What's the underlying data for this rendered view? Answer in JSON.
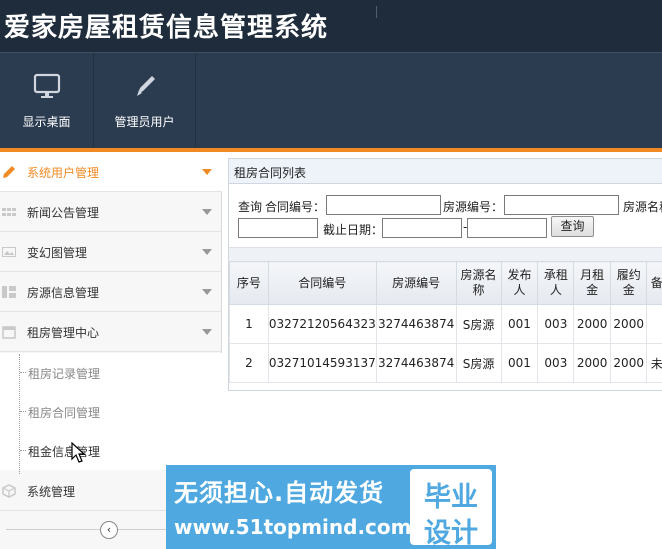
{
  "app": {
    "title": "爱家房屋租赁信息管理系统"
  },
  "toolbar": {
    "items": [
      {
        "label": "显示桌面",
        "icon": "monitor-icon"
      },
      {
        "label": "管理员用户",
        "icon": "pencil-icon"
      }
    ]
  },
  "sidebar": {
    "menus": [
      {
        "label": "系统用户管理",
        "icon": "pencil-icon",
        "active": true
      },
      {
        "label": "新闻公告管理",
        "icon": "grid-icon"
      },
      {
        "label": "变幻图管理",
        "icon": "image-icon"
      },
      {
        "label": "房源信息管理",
        "icon": "tiles-icon"
      },
      {
        "label": "租房管理中心",
        "icon": "calendar-icon",
        "expanded": true
      }
    ],
    "submenus": [
      {
        "label": "租房记录管理"
      },
      {
        "label": "租房合同管理"
      },
      {
        "label": "租金信息管理",
        "current": true
      }
    ],
    "bottom_menu": {
      "label": "系统管理",
      "icon": "box-icon"
    },
    "collapse_glyph": "‹"
  },
  "panel": {
    "title": "租房合同列表",
    "search": {
      "query_label": "查询",
      "contract_no_label": "合同编号：",
      "house_no_label": "房源编号：",
      "house_name_label": "房源名称",
      "deadline_label": "截止日期：",
      "date_separator": "-",
      "contract_no_value": "",
      "house_no_value": "",
      "house_name_value": "",
      "date_from_value": "",
      "date_to_value": "",
      "button_label": "查询"
    },
    "table": {
      "headers": [
        "序号",
        "合同编号",
        "房源编号",
        "房源名称",
        "发布人",
        "承租人",
        "月租金",
        "履约金",
        "备"
      ],
      "rows": [
        [
          "1",
          "03272120564323",
          "3274463874",
          "S房源",
          "001",
          "003",
          "2000",
          "2000",
          ""
        ],
        [
          "2",
          "03271014593137",
          "3274463874",
          "S房源",
          "001",
          "003",
          "2000",
          "2000",
          "未"
        ]
      ]
    }
  },
  "watermark": {
    "line1": "无须担心.自动发货",
    "line2": "www.51topmind.com",
    "right_top": "毕业",
    "right_bottom": "设计"
  },
  "colors": {
    "header_bg": "#2a3a4e",
    "accent": "#f08a24",
    "panel_head": "#eef3fa",
    "watermark_blue": "#4fa8e0"
  }
}
